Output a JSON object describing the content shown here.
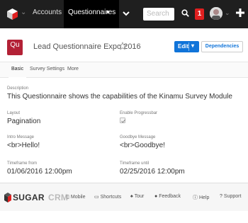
{
  "nav": {
    "accounts_label": "Accounts",
    "questionnaires_label": "Questionnaires",
    "search_placeholder": "Search",
    "notifications_count": "1"
  },
  "record": {
    "module_badge": "Qu",
    "title": "Lead Questionnaire Expo 2016",
    "edit_label": "Edit",
    "dependencies_label": "Dependencies"
  },
  "tabs": [
    {
      "label": "Basic"
    },
    {
      "label": "Survey Settings"
    },
    {
      "label": "More"
    }
  ],
  "fields": {
    "description": {
      "label": "Description",
      "value": "This Questionnaire shows the capabilities of the Kinamu Survey Module"
    },
    "layout": {
      "label": "Layout",
      "value": "Pagination"
    },
    "enable_progressbar": {
      "label": "Enable Progressbar",
      "checked": true
    },
    "intro_message": {
      "label": "Intro Message",
      "value": "<br>Hello!"
    },
    "goodbye_message": {
      "label": "Goodbye Message",
      "value": "<br>Goodbye!"
    },
    "timeframe_from": {
      "label": "Timeframe from",
      "value": "01/06/2016 12:00pm"
    },
    "timeframe_until": {
      "label": "Timeframe until",
      "value": "02/25/2016 12:00pm"
    }
  },
  "footer": {
    "brand_sugar": "SUGAR",
    "brand_crm": "CRM",
    "mobile_label": "Mobile",
    "shortcuts_label": "Shortcuts",
    "tour_label": "Tour",
    "feedback_label": "Feedback",
    "help_label": "Help",
    "support_label": "Support"
  },
  "colors": {
    "topbar": "#1f1f1f",
    "primary": "#1074d9",
    "module_badge": "#b32136",
    "notification": "#e02020"
  }
}
